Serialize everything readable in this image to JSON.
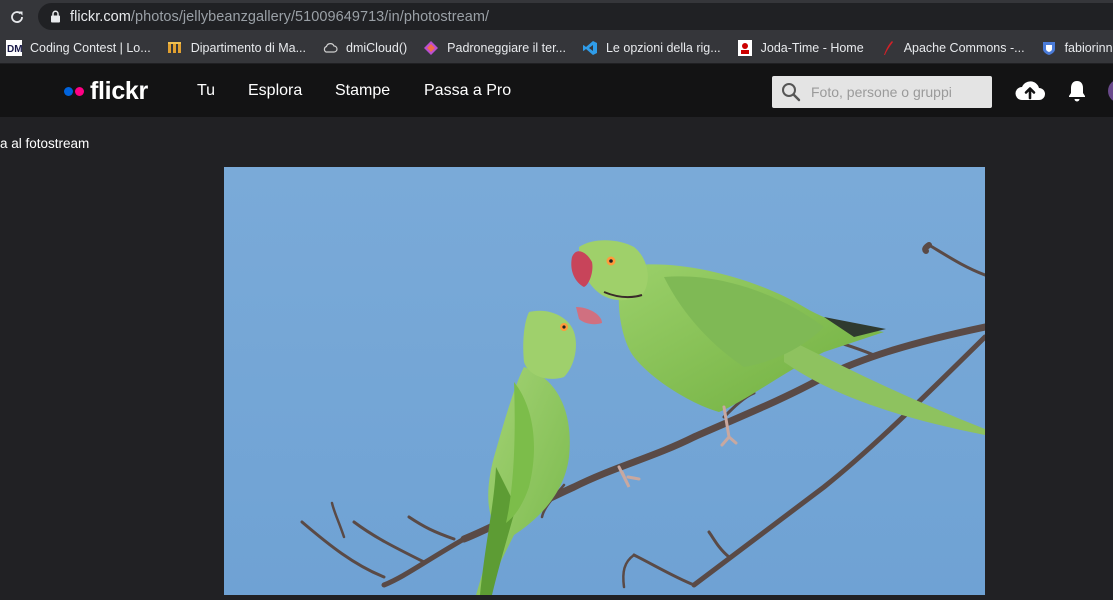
{
  "browser": {
    "url_host": "flickr.com",
    "url_path": "/photos/jellybeanzgallery/51009649713/in/photostream/",
    "bookmarks": [
      {
        "label": "Coding Contest | Lo...",
        "icon": "dmi-icon"
      },
      {
        "label": "Dipartimento di Ma...",
        "icon": "unipg-icon"
      },
      {
        "label": "dmiCloud()",
        "icon": "cloud-icon"
      },
      {
        "label": "Padroneggiare il ter...",
        "icon": "diamond-icon"
      },
      {
        "label": "Le opzioni della rig...",
        "icon": "vscode-icon"
      },
      {
        "label": "Joda-Time - Home",
        "icon": "joda-icon"
      },
      {
        "label": "Apache Commons -...",
        "icon": "feather-icon"
      },
      {
        "label": "fabiorinnone /",
        "icon": "shield-icon"
      }
    ]
  },
  "flickr": {
    "logo": "flickr",
    "nav": [
      "Tu",
      "Esplora",
      "Stampe",
      "Passa a Pro"
    ],
    "search_placeholder": "Foto, persone o gruppi",
    "back_link": "a al fotostream"
  },
  "colors": {
    "flickr_blue": "#0063dc",
    "flickr_pink": "#ff0084",
    "sky": "#79a9d9"
  }
}
